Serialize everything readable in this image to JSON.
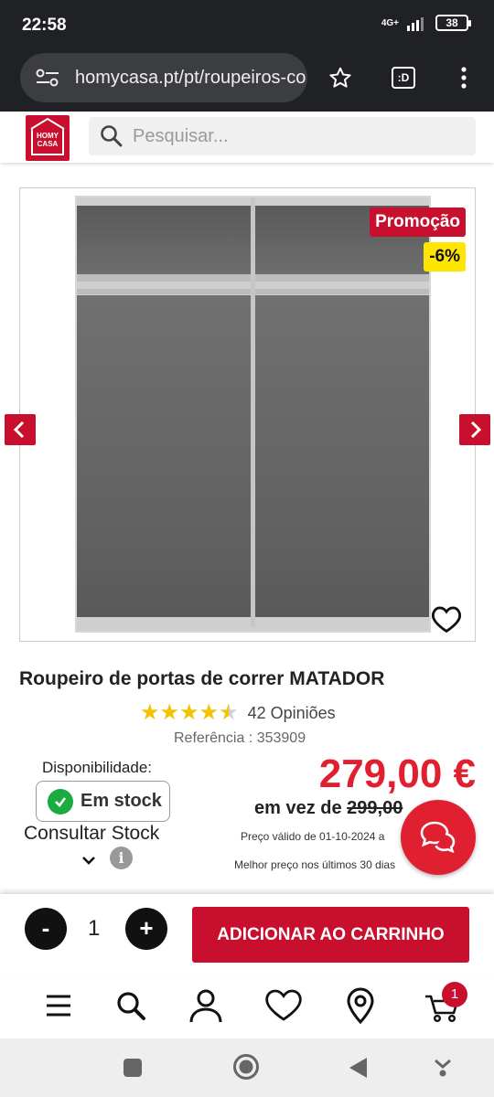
{
  "status_bar": {
    "time": "22:58",
    "network": "4G+",
    "battery": "38"
  },
  "browser": {
    "url": "homycasa.pt/pt/roupeiros-co",
    "tab_count": ":D"
  },
  "header": {
    "logo_line1": "HOMY",
    "logo_line2": "CASA",
    "search_placeholder": "Pesquisar..."
  },
  "product": {
    "promo_badge": "Promoção",
    "discount_badge": "-6%",
    "title": "Roupeiro de portas de correr MATADOR",
    "rating": 4.5,
    "rating_max": 5,
    "reviews": "42 Opiniões",
    "reference": "Referência : 353909",
    "availability_label": "Disponibilidade:",
    "stock_status": "Em stock",
    "consult_stock": "Consultar Stock",
    "price": "279,00 €",
    "was_prefix": "em vez de",
    "was_price": "299,00",
    "price_valid": "Preço válido de 01-10-2024 a",
    "best_price": "Melhor preço nos últimos 30 dias",
    "best_price_suffix": "€"
  },
  "cart": {
    "minus": "-",
    "quantity": "1",
    "plus": "+",
    "add_to_cart": "ADICIONAR AO CARRINHO",
    "badge": "1"
  },
  "colors": {
    "brand_red": "#c8102e",
    "price_red": "#e01f30",
    "promo_yellow": "#ffe600",
    "stock_green": "#1bab3f",
    "star_gold": "#f2c400"
  }
}
